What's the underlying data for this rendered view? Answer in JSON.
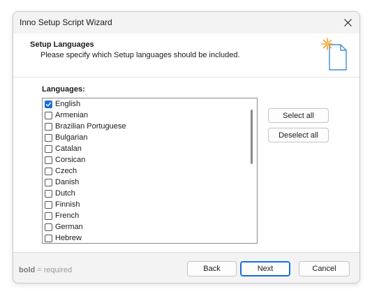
{
  "window": {
    "title": "Inno Setup Script Wizard"
  },
  "header": {
    "heading": "Setup Languages",
    "subheading": "Please specify which Setup languages should be included."
  },
  "languages": {
    "label": "Languages:",
    "items": [
      {
        "name": "English",
        "checked": true
      },
      {
        "name": "Armenian",
        "checked": false
      },
      {
        "name": "Brazilian Portuguese",
        "checked": false
      },
      {
        "name": "Bulgarian",
        "checked": false
      },
      {
        "name": "Catalan",
        "checked": false
      },
      {
        "name": "Corsican",
        "checked": false
      },
      {
        "name": "Czech",
        "checked": false
      },
      {
        "name": "Danish",
        "checked": false
      },
      {
        "name": "Dutch",
        "checked": false
      },
      {
        "name": "Finnish",
        "checked": false
      },
      {
        "name": "French",
        "checked": false
      },
      {
        "name": "German",
        "checked": false
      },
      {
        "name": "Hebrew",
        "checked": false
      }
    ]
  },
  "actions": {
    "select_all": "Select all",
    "deselect_all": "Deselect all"
  },
  "footer": {
    "hint_bold": "bold",
    "hint_rest": " = required",
    "back": "Back",
    "next": "Next",
    "cancel": "Cancel"
  },
  "colors": {
    "accent": "#1a6ed8",
    "icon_star": "#f0a030",
    "icon_doc": "#3a8fd8"
  },
  "icons": {
    "close": "close-icon",
    "document": "wizard-document-icon",
    "checkmark": "checkmark-icon"
  }
}
